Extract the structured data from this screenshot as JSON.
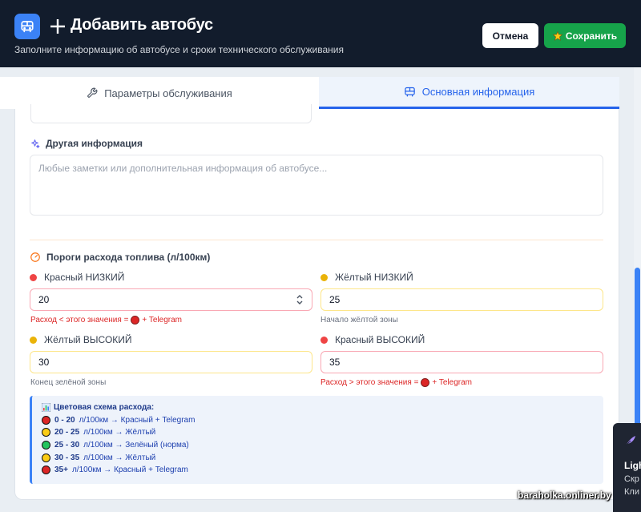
{
  "header": {
    "title": "Добавить автобус",
    "subtitle": "Заполните информацию об автобусе и сроки технического обслуживания",
    "cancel_label": "Отмена",
    "save_label": "Сохранить",
    "app_icon": "bus-icon",
    "title_icon": "plus-icon",
    "save_icon": "medal-icon"
  },
  "tabs": [
    {
      "label": "Параметры обслуживания",
      "icon": "wrench-icon",
      "active": false
    },
    {
      "label": "Основная информация",
      "icon": "bus-icon",
      "active": true
    }
  ],
  "other_info": {
    "label": "Другая информация",
    "icon": "sparkles-icon",
    "placeholder": "Любые заметки или дополнительная информация об автобусе...",
    "value": ""
  },
  "fuel": {
    "title": "Пороги расхода топлива (л/100км)",
    "icon": "gauge-icon",
    "fields": {
      "red_low": {
        "label": "Красный НИЗКИЙ",
        "value": "20",
        "hint_before": "Расход < этого значения =",
        "hint_after": "+ Telegram",
        "dot_color": "#ef4444"
      },
      "yellow_low": {
        "label": "Жёлтый НИЗКИЙ",
        "value": "25",
        "hint": "Начало жёлтой зоны",
        "dot_color": "#eab308"
      },
      "yellow_high": {
        "label": "Жёлтый ВЫСОКИЙ",
        "value": "30",
        "hint": "Конец зелёной зоны",
        "dot_color": "#eab308"
      },
      "red_high": {
        "label": "Красный ВЫСОКИЙ",
        "value": "35",
        "hint_before": "Расход > этого значения =",
        "hint_after": "+ Telegram",
        "dot_color": "#ef4444"
      }
    }
  },
  "scheme": {
    "title": "Цветовая схема расхода:",
    "icon": "bar-chart-icon",
    "rows": [
      {
        "range": "0 - 20",
        "text": "л/100км → Красный + Telegram",
        "color": "#dc2626"
      },
      {
        "range": "20 - 25",
        "text": "л/100км → Жёлтый",
        "color": "#facc15"
      },
      {
        "range": "25 - 30",
        "text": "л/100км → Зелёный (норма)",
        "color": "#22c55e"
      },
      {
        "range": "30 - 35",
        "text": "л/100км → Жёлтый",
        "color": "#facc15"
      },
      {
        "range": "35+",
        "text": "л/100км → Красный + Telegram",
        "color": "#dc2626"
      }
    ]
  },
  "popup": {
    "title": "Ligh",
    "line1": "Скр",
    "line2": "Кли",
    "icon": "feather-icon"
  },
  "watermark": "baraholka.onliner.by"
}
